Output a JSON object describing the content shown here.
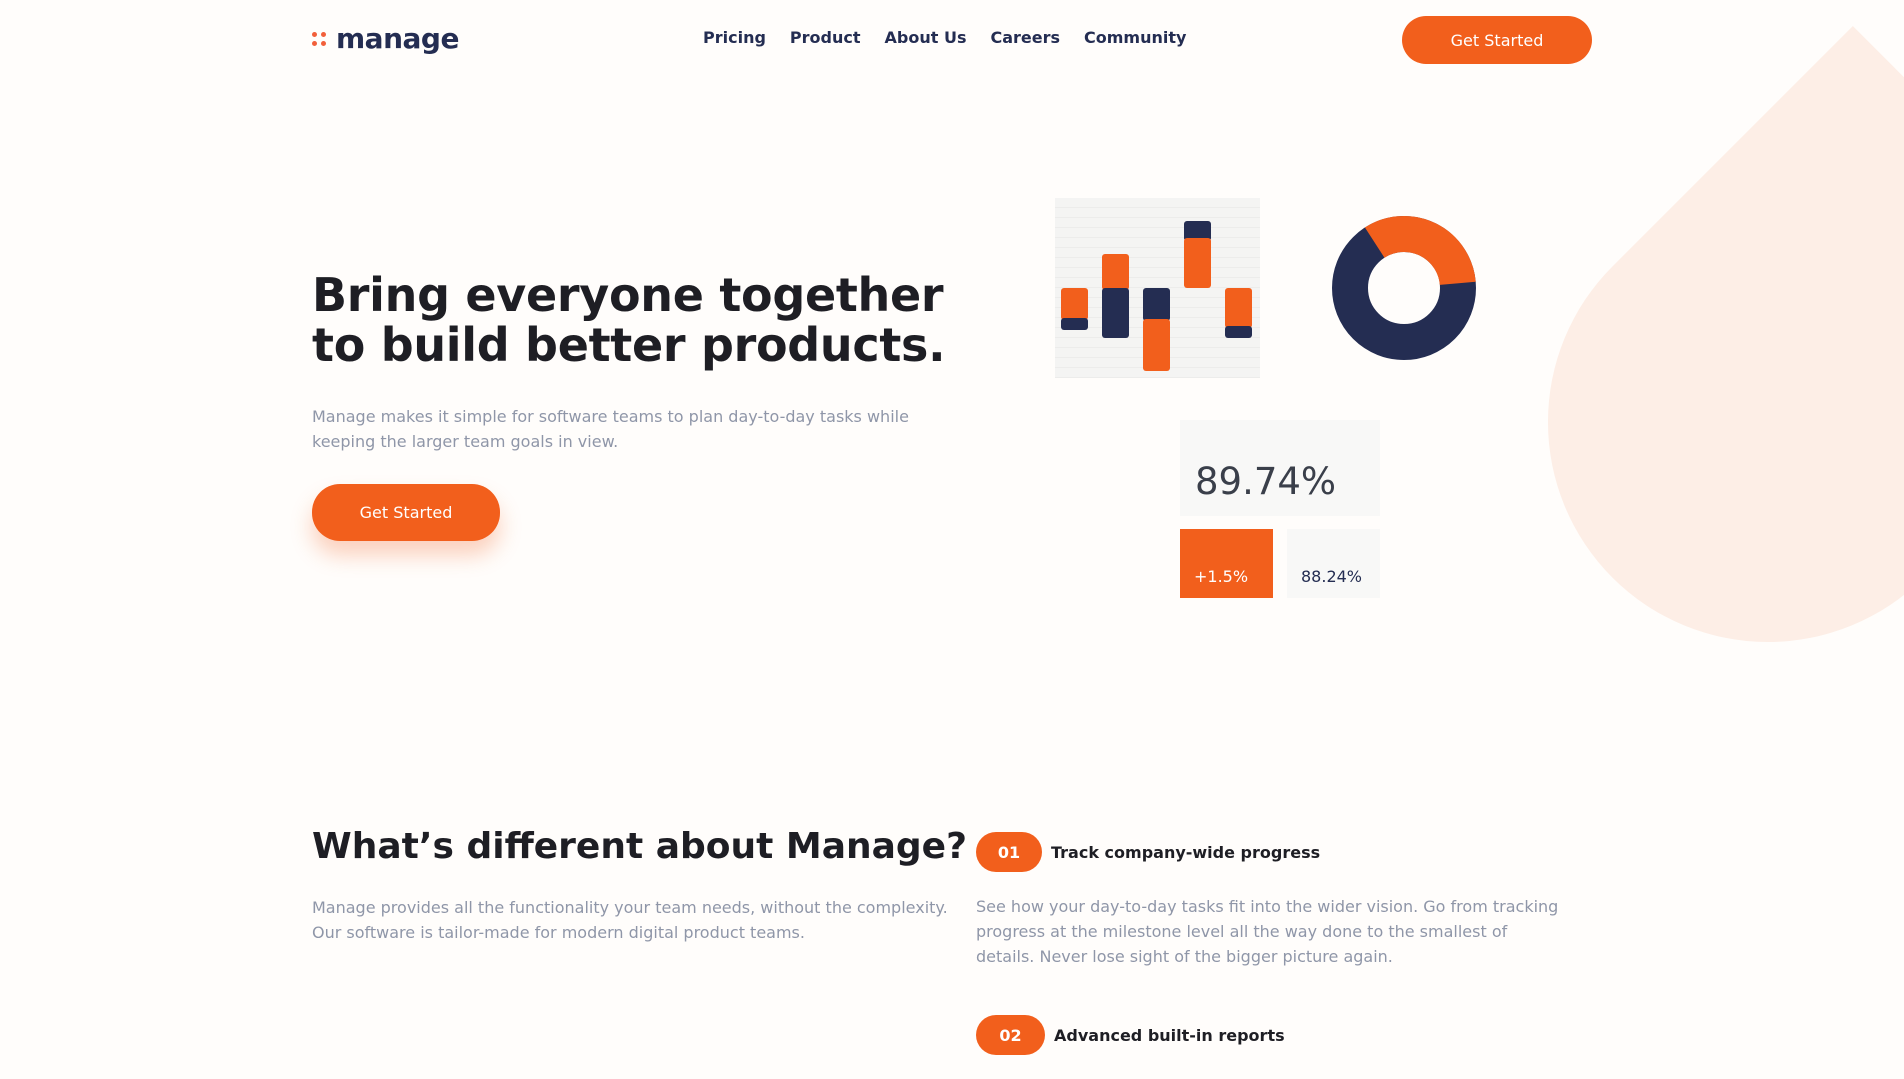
{
  "header": {
    "logo_text": "manage",
    "nav": [
      "Pricing",
      "Product",
      "About Us",
      "Careers",
      "Community"
    ],
    "cta_label": "Get Started"
  },
  "hero": {
    "title_line1": "Bring everyone together",
    "title_line2": "to build better products.",
    "description": "Manage makes it simple for software teams to plan day-to-day tasks while keeping the larger team goals in view.",
    "cta_label": "Get Started"
  },
  "illustration": {
    "big_stat": "89.74%",
    "change": "+1.5%",
    "small_stat": "88.24%"
  },
  "features": {
    "title": "What’s different about Manage?",
    "description": "Manage provides all the functionality your team needs, without the complexity. Our software is tailor-made for modern digital product teams.",
    "items": [
      {
        "number": "01",
        "title": "Track company-wide progress",
        "description": "See how your day-to-day tasks fit into the wider vision. Go from tracking progress at the milestone level all the way done to the smallest of details. Never lose sight of the bigger picture again."
      },
      {
        "number": "02",
        "title": "Advanced built-in reports",
        "description": ""
      }
    ]
  },
  "colors": {
    "accent": "#f25f1c",
    "navy": "#242d52",
    "background": "#fffdfb",
    "deco": "#fdeee6"
  }
}
